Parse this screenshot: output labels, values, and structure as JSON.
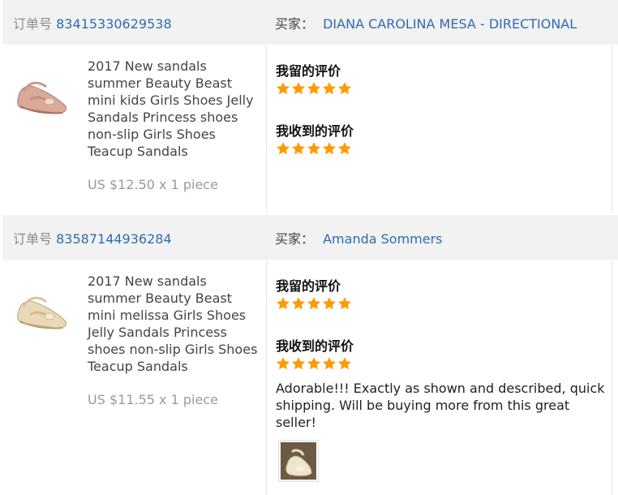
{
  "labels": {
    "order_no": "订单号",
    "buyer": "买家：",
    "my_review": "我留的评价",
    "received_review": "我收到的评价"
  },
  "colors": {
    "link": "#2e6bb0",
    "star": "#ff9a00",
    "header_bg": "#f2f2f2"
  },
  "orders": [
    {
      "order_no": "83415330629538",
      "buyer": "DIANA CAROLINA MESA - DIRECTIONAL",
      "product_title": "2017 New sandals summer Beauty Beast mini kids Girls Shoes Jelly Sandals Princess shoes non-slip Girls Shoes Teacup Sandals",
      "price_line": "US $12.50 x 1 piece",
      "thumbnail_icon": "pink-jelly-sandal-image",
      "my_rating": 5,
      "received_rating": 5,
      "review_text": "",
      "has_photo": false
    },
    {
      "order_no": "83587144936284",
      "buyer": "Amanda Sommers",
      "product_title": "2017 New sandals summer Beauty Beast mini melissa Girls Shoes Jelly Sandals Princess shoes non-slip Girls Shoes Teacup Sandals",
      "price_line": "US $11.55 x 1 piece",
      "thumbnail_icon": "gold-jelly-sandal-image",
      "my_rating": 5,
      "received_rating": 5,
      "review_text": "Adorable!!! Exactly as shown and described, quick shipping. Will be buying more from this great seller!",
      "has_photo": true
    }
  ]
}
